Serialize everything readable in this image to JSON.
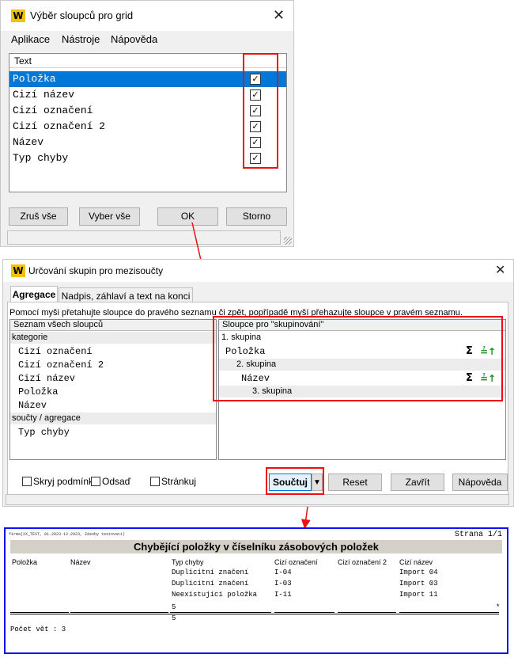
{
  "win1": {
    "title": "Výběr sloupců pro grid",
    "logo": "W",
    "menu": [
      "Aplikace",
      "Nástroje",
      "Nápověda"
    ],
    "grid_header": "Text",
    "rows": [
      {
        "label": "Položka",
        "checked": true
      },
      {
        "label": "Cizí název",
        "checked": true
      },
      {
        "label": "Cizí označení",
        "checked": true
      },
      {
        "label": "Cizí označení 2",
        "checked": true
      },
      {
        "label": "Název",
        "checked": true
      },
      {
        "label": "Typ chyby",
        "checked": true
      }
    ],
    "buttons": {
      "clear_all": "Zruš vše",
      "select_all": "Vyber vše",
      "ok": "OK",
      "cancel": "Storno"
    }
  },
  "win2": {
    "title": "Určování skupin pro mezisoučty",
    "logo": "W",
    "tabs": [
      "Agregace",
      "Nadpis, záhlaví a text na konci"
    ],
    "hint": "Pomocí myši přetahujte sloupce do pravého seznamu či zpět, popřípadě myší přehazujte sloupce v pravém seznamu.",
    "left_panel": {
      "header": "Seznam všech sloupců",
      "group1": "kategorie",
      "items1": [
        "Cizí označení",
        "Cizí označení 2",
        "Cizí název",
        "Položka",
        "Název"
      ],
      "group2": "součty / agregace",
      "items2": [
        "Typ chyby"
      ]
    },
    "right_panel": {
      "header": "Sloupce pro \"skupinování\"",
      "group1": "1. skupina",
      "col1": "Položka",
      "group2": "2. skupina",
      "col2": "Název",
      "group3": "3. skupina",
      "sigma": "Σ",
      "sort": "≟↑"
    },
    "bottom": {
      "hide_condition": "Skryj podmínku",
      "indent": "Odsaď",
      "paginate": "Stránkuj",
      "sum_button": "Součtuj",
      "dropdown": "▼",
      "reset": "Reset",
      "close": "Zavřít",
      "help": "Nápověda"
    }
  },
  "report": {
    "header_small": "firma(XX_TEST, 01.2023-12.2023, Zásoby testovací)",
    "page": "Strana 1/1",
    "title": "Chybějící položky v číselníku zásobových položek",
    "columns": [
      "Položka",
      "Název",
      "Typ chyby",
      "Cizí označení",
      "Cizí označení 2",
      "Cizí název"
    ],
    "rows": [
      {
        "typ": "Duplicitní značení",
        "oznaceni": "I-04",
        "nazev": "Import 04"
      },
      {
        "typ": "Duplicitní značení",
        "oznaceni": "I-03",
        "nazev": "Import 03"
      },
      {
        "typ": "Neexistující položka",
        "oznaceni": "I-11",
        "nazev": "Import 11"
      }
    ],
    "subtotal": "5",
    "asterisk": "*",
    "total": "5",
    "count_label": "Počet vět : 3"
  },
  "colors": {
    "highlight_red": "#ee1010",
    "selection_blue": "#0078d7",
    "report_border": "#1010ee"
  }
}
